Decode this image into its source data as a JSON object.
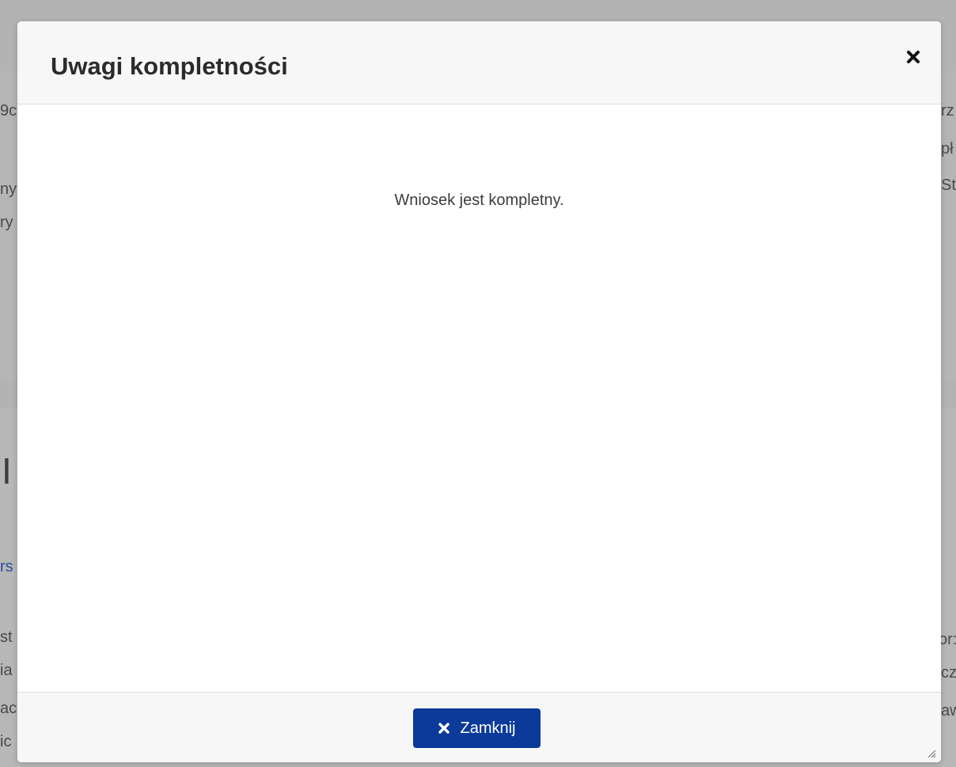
{
  "modal": {
    "title": "Uwagi kompletności",
    "message": "Wniosek jest kompletny.",
    "close_button_label": "Zamknij",
    "close_icon": "close-icon",
    "accent_color": "#0b3a9a"
  },
  "background": {
    "fragments_left": [
      "9c",
      "ny",
      "ry",
      "I",
      "rs",
      "st",
      "ia",
      "ac",
      "ic"
    ],
    "fragments_right": [
      "rz",
      "pł",
      "St",
      "or:",
      "cz",
      "aw"
    ]
  }
}
